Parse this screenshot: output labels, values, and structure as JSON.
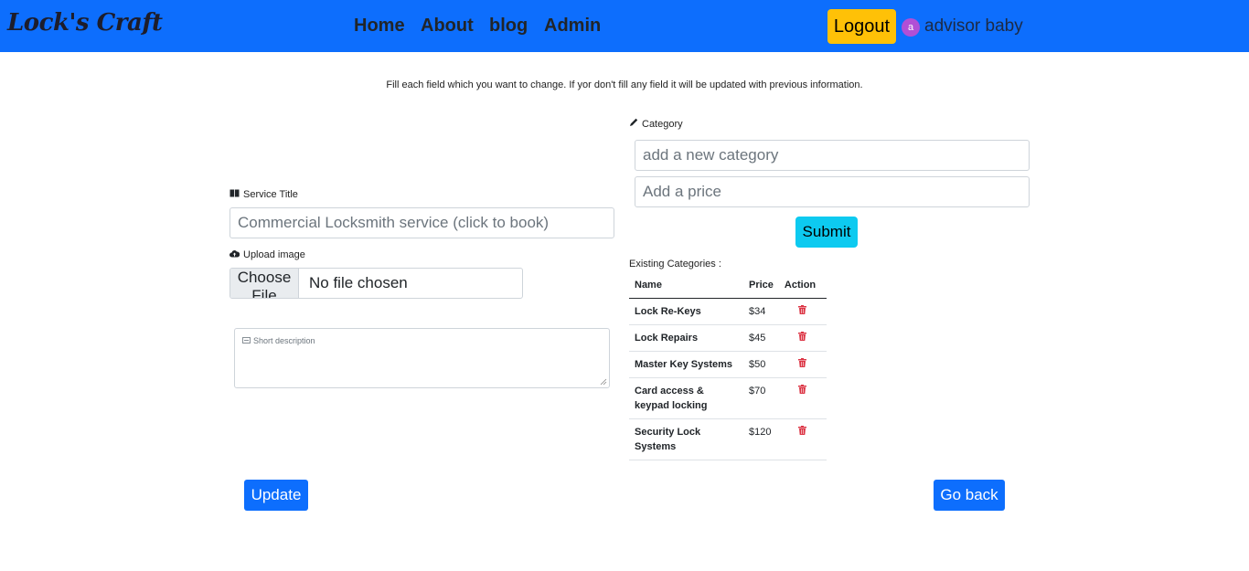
{
  "navbar": {
    "brand": "Lock's Craft",
    "links": [
      "Home",
      "About",
      "blog",
      "Admin"
    ],
    "logout_label": "Logout",
    "user_initial": "a",
    "user_name": "advisor baby"
  },
  "notice": "Fill each field which you want to change. If yor don't fill any field it will be updated with previous information.",
  "service_form": {
    "title_label": "Service Title",
    "title_placeholder": "Commercial Locksmith service (click to book)",
    "upload_label": "Upload image",
    "file_button": "Choose File",
    "file_status": "No file chosen",
    "description_placeholder": "Short description"
  },
  "category_form": {
    "label": "Category",
    "category_placeholder": "add a new category",
    "price_placeholder": "Add a price",
    "submit_label": "Submit"
  },
  "existing_categories": {
    "label": "Existing Categories :",
    "columns": [
      "Name",
      "Price",
      "Action"
    ],
    "rows": [
      {
        "name": "Lock Re-Keys",
        "price": "$34"
      },
      {
        "name": "Lock Repairs",
        "price": "$45"
      },
      {
        "name": "Master Key Systems",
        "price": "$50"
      },
      {
        "name": "Card access & keypad locking",
        "price": "$70"
      },
      {
        "name": "Security Lock Systems",
        "price": "$120"
      }
    ]
  },
  "actions": {
    "update_label": "Update",
    "go_back_label": "Go back"
  },
  "colors": {
    "navbar": "#0d6efd",
    "logout": "#ffc107",
    "submit": "#0dcaf0",
    "primary": "#0d6efd",
    "delete": "#dc3545"
  }
}
